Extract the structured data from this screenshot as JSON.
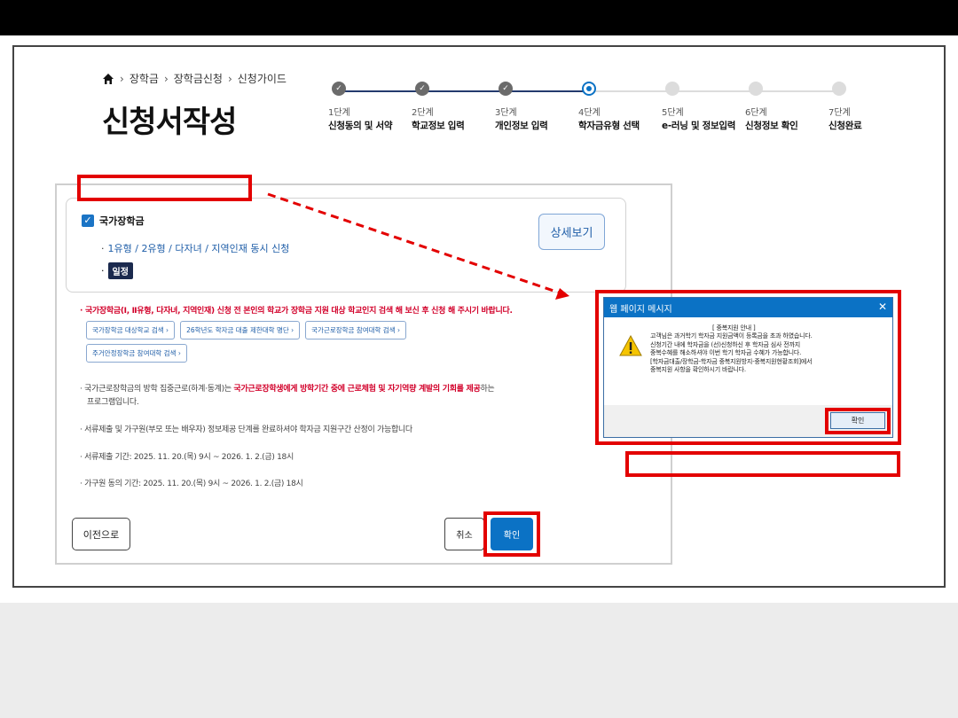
{
  "breadcrumb": {
    "items": [
      "장학금",
      "장학금신청",
      "신청가이드"
    ]
  },
  "page_title": "신청서작성",
  "steps": [
    {
      "num": "1단계",
      "label": "신청동의 및 서약",
      "state": "done"
    },
    {
      "num": "2단계",
      "label": "학교정보 입력",
      "state": "done"
    },
    {
      "num": "3단계",
      "label": "개인정보 입력",
      "state": "done"
    },
    {
      "num": "4단계",
      "label": "학자금유형 선택",
      "state": "current"
    },
    {
      "num": "5단계",
      "label": "e-러닝 및 정보입력",
      "state": "todo"
    },
    {
      "num": "6단계",
      "label": "신청정보 확인",
      "state": "todo"
    },
    {
      "num": "7단계",
      "label": "신청완료",
      "state": "todo"
    }
  ],
  "card": {
    "title": "국가장학금",
    "types": "1유형 / 2유형 / 다자녀 / 지역인재 동시 신청",
    "badge": "일정",
    "detail_button": "상세보기"
  },
  "notice_red": "국가장학금(Ⅰ, Ⅱ유형, 다자녀, 지역인재) 신청 전 본인의 학교가 장학금 지원 대상 학교인지 검색 해 보신 후 신청 해 주시기 바랍니다.",
  "link_buttons": [
    "국가장학금 대상학교 검색",
    "26학년도 학자금 대출 제한대학 명단",
    "국가근로장학금 참여대학 검색",
    "주거안정장학금 참여대학 검색"
  ],
  "notes": {
    "n1_pre": "국가근로장학금의 방학 집중근로(하계·동계)는 ",
    "n1_hl": "국가근로장학생에게 방학기간 중에 근로체험 및 자기역량 계발의 기회를 제공",
    "n1_post": "하는",
    "n1_line2": "프로그램입니다.",
    "n2": "서류제출 및 가구원(부모 또는 배우자) 정보제공 단계를 완료하셔야 학자금 지원구간 산정이 가능합니다",
    "n3": "서류제출 기간: 2025. 11. 20.(목) 9시 ~ 2026. 1. 2.(금) 18시",
    "n4": "가구원 동의 기간: 2025. 11. 20.(목) 9시 ~ 2026. 1. 2.(금) 18시"
  },
  "buttons": {
    "prev": "이전으로",
    "cancel": "취소",
    "ok": "확인"
  },
  "dialog": {
    "title": "웹 페이지 메시지",
    "close": "✕",
    "lines": [
      "[ 중복지원 안내 ]",
      "고객님은 과거학기 학자금 지원금액이 등록금을 초과 하였습니다.",
      "신청기간 내에 학자금을 (선)신청하신 후 학자금 심사 전까지",
      "중복수혜를 해소하셔야 이번 학기 학자금 수혜가 가능합니다.",
      "[학자금대출/장학금-학자금 중복지원방지-중복지원현황조회]에서",
      "중복지원 사항을 확인하시기 바랍니다."
    ],
    "ok": "확인"
  },
  "colors": {
    "accent": "#0b72c5",
    "highlight": "#e30000",
    "notice": "#d2002a"
  }
}
